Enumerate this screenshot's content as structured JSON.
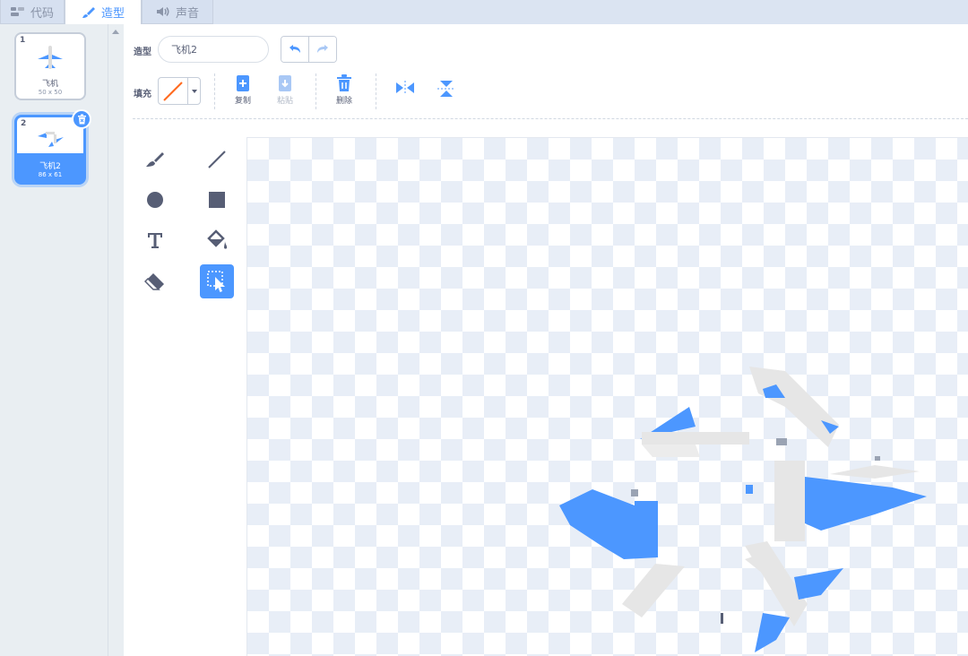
{
  "tabs": [
    {
      "label": "代码",
      "icon": "code-icon"
    },
    {
      "label": "造型",
      "icon": "brush-icon"
    },
    {
      "label": "声音",
      "icon": "speaker-icon"
    }
  ],
  "costumes": [
    {
      "number": "1",
      "name": "飞机",
      "size": "50 x 50"
    },
    {
      "number": "2",
      "name": "飞机2",
      "size": "86 x 61"
    }
  ],
  "editor": {
    "costume_label": "造型",
    "costume_name": "飞机2",
    "fill_label": "填充",
    "copy_label": "复制",
    "paste_label": "粘贴",
    "delete_label": "删除"
  },
  "colors": {
    "accent": "#4c97ff",
    "fill_swatch": "#ff6a1f",
    "plane_blue": "#4c97ff",
    "plane_body": "#e6e6e6"
  },
  "tools": [
    "brush-icon",
    "line-icon",
    "circle-icon",
    "rectangle-icon",
    "text-icon",
    "fill-bucket-icon",
    "eraser-icon",
    "select-icon"
  ]
}
